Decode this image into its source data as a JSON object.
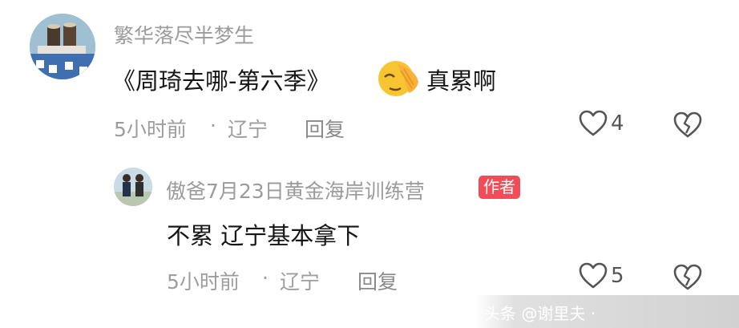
{
  "comment": {
    "username": "繁华落尽半梦生",
    "text_before": "《周琦去哪-第六季》",
    "emoji": "face-palm-emoji",
    "text_after": "真累啊",
    "time": "5小时前",
    "location": "辽宁",
    "reply_label": "回复",
    "like_count": "4"
  },
  "reply": {
    "username": "傲爸7月23日黄金海岸训练营",
    "badge": "作者",
    "text": "不累 辽宁基本拿下",
    "time": "5小时前",
    "location": "辽宁",
    "reply_label": "回复",
    "like_count": "5"
  },
  "meta_separator": "·",
  "watermark": {
    "text": "头条 @谢里夫 · "
  },
  "colors": {
    "badge": "#f04d58",
    "username": "#9b9b9b",
    "meta": "#9d9d9d"
  }
}
